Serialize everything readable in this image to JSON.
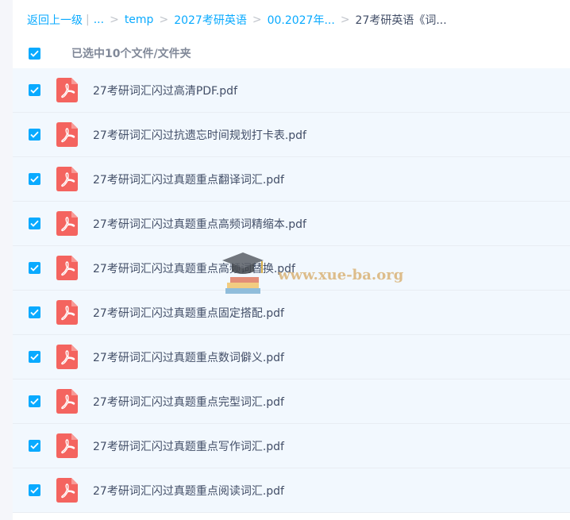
{
  "breadcrumb": {
    "back_label": "返回上一级",
    "ellipsis": "...",
    "items": [
      "temp",
      "2027考研英语",
      "00.2027年..."
    ],
    "current": "27考研英语《词..."
  },
  "selection": {
    "summary": "已选中10个文件/文件夹",
    "all_checked": true
  },
  "files": [
    {
      "name": "27考研词汇闪过高清PDF.pdf",
      "checked": true,
      "icon": "pdf-icon"
    },
    {
      "name": "27考研词汇闪过抗遗忘时间规划打卡表.pdf",
      "checked": true,
      "icon": "pdf-icon"
    },
    {
      "name": "27考研词汇闪过真题重点翻译词汇.pdf",
      "checked": true,
      "icon": "pdf-icon"
    },
    {
      "name": "27考研词汇闪过真题重点高频词精缩本.pdf",
      "checked": true,
      "icon": "pdf-icon"
    },
    {
      "name": "27考研词汇闪过真题重点高频词替换.pdf",
      "checked": true,
      "icon": "pdf-icon"
    },
    {
      "name": "27考研词汇闪过真题重点固定搭配.pdf",
      "checked": true,
      "icon": "pdf-icon"
    },
    {
      "name": "27考研词汇闪过真题重点数词僻义.pdf",
      "checked": true,
      "icon": "pdf-icon"
    },
    {
      "name": "27考研词汇闪过真题重点完型词汇.pdf",
      "checked": true,
      "icon": "pdf-icon"
    },
    {
      "name": "27考研词汇闪过真题重点写作词汇.pdf",
      "checked": true,
      "icon": "pdf-icon"
    },
    {
      "name": "27考研词汇闪过真题重点阅读词汇.pdf",
      "checked": true,
      "icon": "pdf-icon"
    }
  ],
  "watermark": {
    "text": "www.xue-ba.org"
  },
  "colors": {
    "accent": "#09aaff",
    "pdf_red": "#f4645f",
    "row_bg": "#f2f8fe",
    "text": "#424e67",
    "muted": "#818999"
  }
}
